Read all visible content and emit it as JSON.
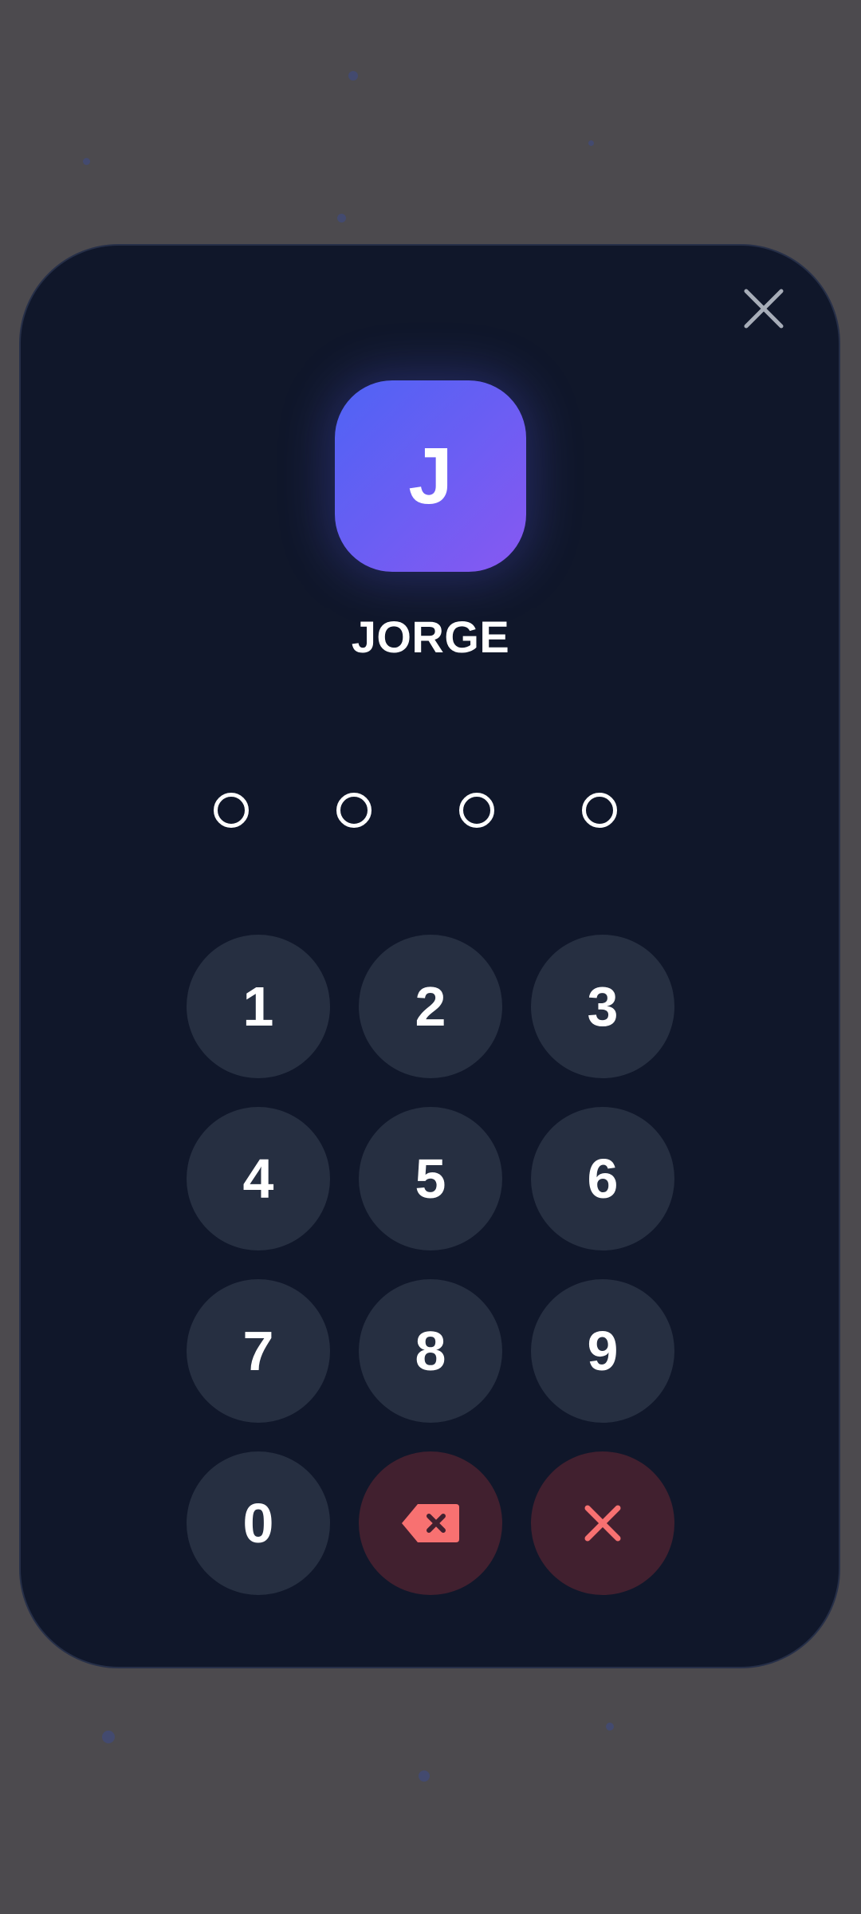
{
  "user": {
    "initial": "J",
    "name": "JORGE"
  },
  "pin": {
    "length": 4,
    "entered": 0
  },
  "keypad": {
    "keys": [
      "1",
      "2",
      "3",
      "4",
      "5",
      "6",
      "7",
      "8",
      "9",
      "0"
    ],
    "backspace_icon": "backspace-icon",
    "clear_icon": "x-icon"
  },
  "colors": {
    "backdrop": "#4c4a4e",
    "card": "#10172a",
    "key": "#262f41",
    "danger_key": "#41202f",
    "danger_icon": "#f87171",
    "avatar_gradient_start": "#4f63f4",
    "avatar_gradient_end": "#8858f2"
  }
}
